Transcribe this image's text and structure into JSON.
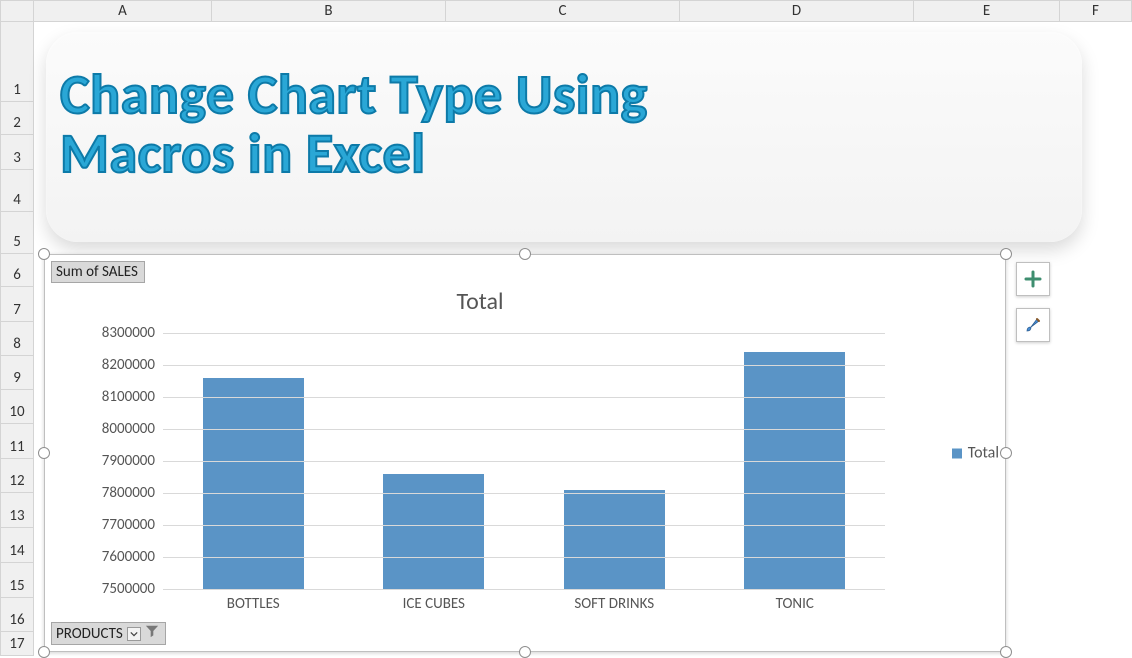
{
  "columns": [
    "A",
    "B",
    "C",
    "D",
    "E",
    "F"
  ],
  "column_rights": [
    212,
    446,
    680,
    914,
    1060,
    1132
  ],
  "rows": [
    1,
    2,
    3,
    4,
    5,
    6,
    7,
    8,
    9,
    10,
    11,
    12,
    13,
    14,
    15,
    16,
    17
  ],
  "row_bottoms": [
    102,
    135,
    170,
    212,
    254,
    287,
    322,
    356,
    390,
    424,
    459,
    493,
    528,
    563,
    598,
    632,
    656
  ],
  "banner_title": "Change Chart Type Using\nMacros in Excel",
  "pivot_fields": {
    "sum": "Sum of SALES",
    "products": "PRODUCTS"
  },
  "chart_data": {
    "type": "bar",
    "title": "Total",
    "legend": "Total",
    "ylabel": "",
    "xlabel": "",
    "ylim": [
      7500000,
      8300000
    ],
    "yticks": [
      7500000,
      7600000,
      7700000,
      7800000,
      7900000,
      8000000,
      8100000,
      8200000,
      8300000
    ],
    "categories": [
      "BOTTLES",
      "ICE CUBES",
      "SOFT DRINKS",
      "TONIC"
    ],
    "values": [
      8160000,
      7860000,
      7810000,
      8240000
    ]
  },
  "colors": {
    "bar": "#5a94c6",
    "accent": "#2aa7d6"
  }
}
